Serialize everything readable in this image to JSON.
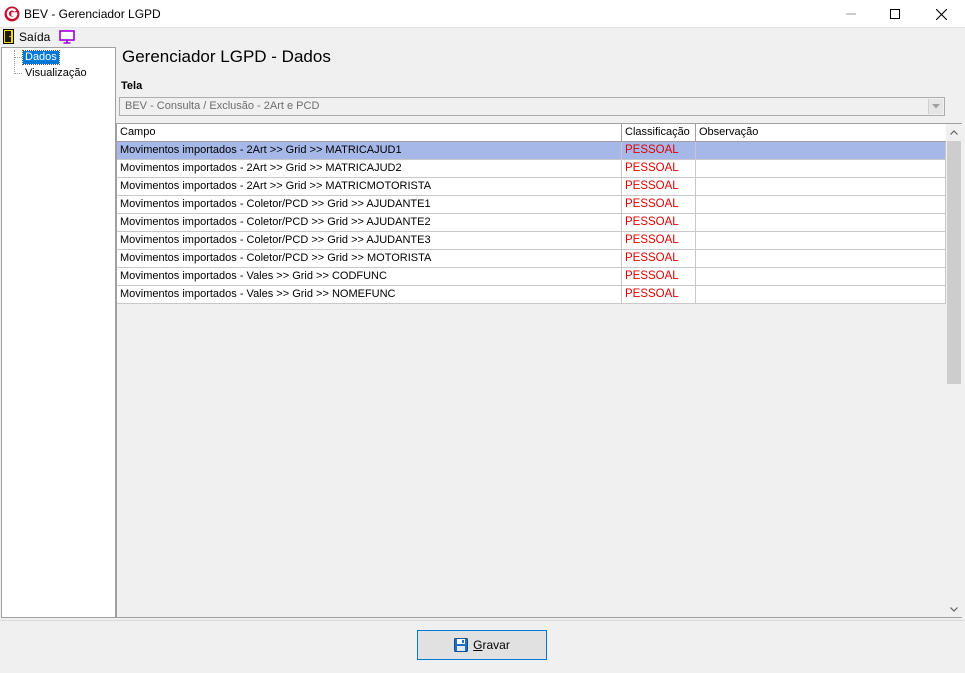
{
  "window": {
    "title": "BEV - Gerenciador LGPD"
  },
  "menubar": {
    "exit_label": "Saída",
    "exit_icon": "exit-door-icon",
    "screen_icon": "monitor-icon"
  },
  "tree": {
    "items": [
      {
        "label": "Dados",
        "selected": true
      },
      {
        "label": "Visualização",
        "selected": false
      }
    ]
  },
  "main": {
    "title": "Gerenciador LGPD - Dados",
    "tela_label": "Tela",
    "tela_value": "BEV - Consulta / Exclusão - 2Art e PCD"
  },
  "grid": {
    "columns": [
      "Campo",
      "Classificação",
      "Observação"
    ],
    "rows": [
      {
        "campo": "Movimentos importados - 2Art >> Grid >> MATRICAJUD1",
        "classificacao": "PESSOAL",
        "observacao": "",
        "selected": true
      },
      {
        "campo": "Movimentos importados - 2Art >> Grid >> MATRICAJUD2",
        "classificacao": "PESSOAL",
        "observacao": ""
      },
      {
        "campo": "Movimentos importados - 2Art >> Grid >> MATRICMOTORISTA",
        "classificacao": "PESSOAL",
        "observacao": ""
      },
      {
        "campo": "Movimentos importados - Coletor/PCD >> Grid >> AJUDANTE1",
        "classificacao": "PESSOAL",
        "observacao": ""
      },
      {
        "campo": "Movimentos importados - Coletor/PCD >> Grid >> AJUDANTE2",
        "classificacao": "PESSOAL",
        "observacao": ""
      },
      {
        "campo": "Movimentos importados - Coletor/PCD >> Grid >> AJUDANTE3",
        "classificacao": "PESSOAL",
        "observacao": ""
      },
      {
        "campo": "Movimentos importados - Coletor/PCD >> Grid >> MOTORISTA",
        "classificacao": "PESSOAL",
        "observacao": ""
      },
      {
        "campo": "Movimentos importados - Vales >> Grid >> CODFUNC",
        "classificacao": "PESSOAL",
        "observacao": ""
      },
      {
        "campo": "Movimentos importados - Vales >> Grid >> NOMEFUNC",
        "classificacao": "PESSOAL",
        "observacao": ""
      }
    ]
  },
  "footer": {
    "save_label": "Gravar",
    "save_icon": "floppy-disk-icon"
  },
  "colors": {
    "selection": "#0078d7",
    "row_highlight": "#a5b8e8",
    "classification_text": "#e00000"
  }
}
